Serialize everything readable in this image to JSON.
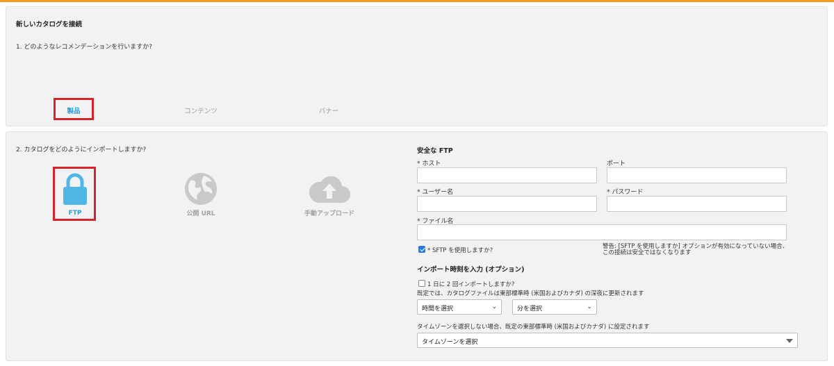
{
  "step1": {
    "heading": "新しいカタログを接続",
    "question": "1. どのようなレコメンデーションを行いますか?",
    "tabs": [
      {
        "label": "製品",
        "active": true
      },
      {
        "label": "コンテンツ",
        "active": false
      },
      {
        "label": "バナー",
        "active": false
      }
    ]
  },
  "step2": {
    "question": "2. カタログをどのようにインポートしますか?",
    "methods": [
      {
        "label": "FTP",
        "icon": "lock-icon",
        "active": true
      },
      {
        "label": "公開 URL",
        "icon": "globe-icon",
        "active": false
      },
      {
        "label": "手動アップロード",
        "icon": "cloud-upload-icon",
        "active": false
      }
    ]
  },
  "ftp_form": {
    "title": "安全な FTP",
    "host_label": "* ホスト",
    "port_label": "ポート",
    "username_label": "* ユーザー名",
    "password_label": "* パスワード",
    "filename_label": "* ファイル名",
    "host_value": "",
    "port_value": "",
    "username_value": "",
    "password_value": "",
    "filename_value": "",
    "sftp_label": "* SFTP を使用しますか?",
    "sftp_checked": true,
    "sftp_warning": "警告: [SFTP を使用しますか] オプションが有効になっていない場合、この接続は安全ではなくなります"
  },
  "import_time": {
    "title": "インポート時刻を入力 (オプション)",
    "twice_label": "1 日に 2 回インポートしますか?",
    "twice_checked": false,
    "default_note": "既定では、カタログファイルは東部標準時 (米国およびカナダ) の深夜に更新されます",
    "hour_select": "時間を選択",
    "minute_select": "分を選択",
    "timezone_note": "タイムゾーンを選択しない場合、既定の東部標準時 (米国およびカナダ) に設定されます",
    "timezone_select": "タイムゾーンを選択"
  },
  "colors": {
    "accent": "#2a9fd8",
    "highlight_box": "#d8232a",
    "top_bar": "#f39a1e",
    "inactive_icon": "#c9c9c9"
  }
}
